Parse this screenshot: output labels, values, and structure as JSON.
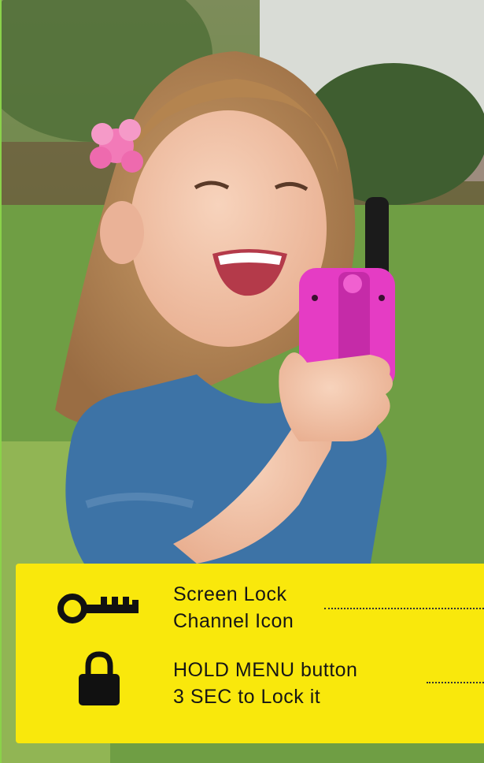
{
  "panel": {
    "items": [
      {
        "icon": "key-icon",
        "line1": "Screen Lock",
        "line2": "Channel Icon"
      },
      {
        "icon": "padlock-icon",
        "line1": "HOLD MENU button",
        "line2": "3 SEC to Lock it"
      }
    ],
    "background": "#f9e80c"
  },
  "photo": {
    "radio_color": "#e53cc4",
    "shirt_color": "#3d73a6",
    "flower_color": "#f27ab8"
  }
}
